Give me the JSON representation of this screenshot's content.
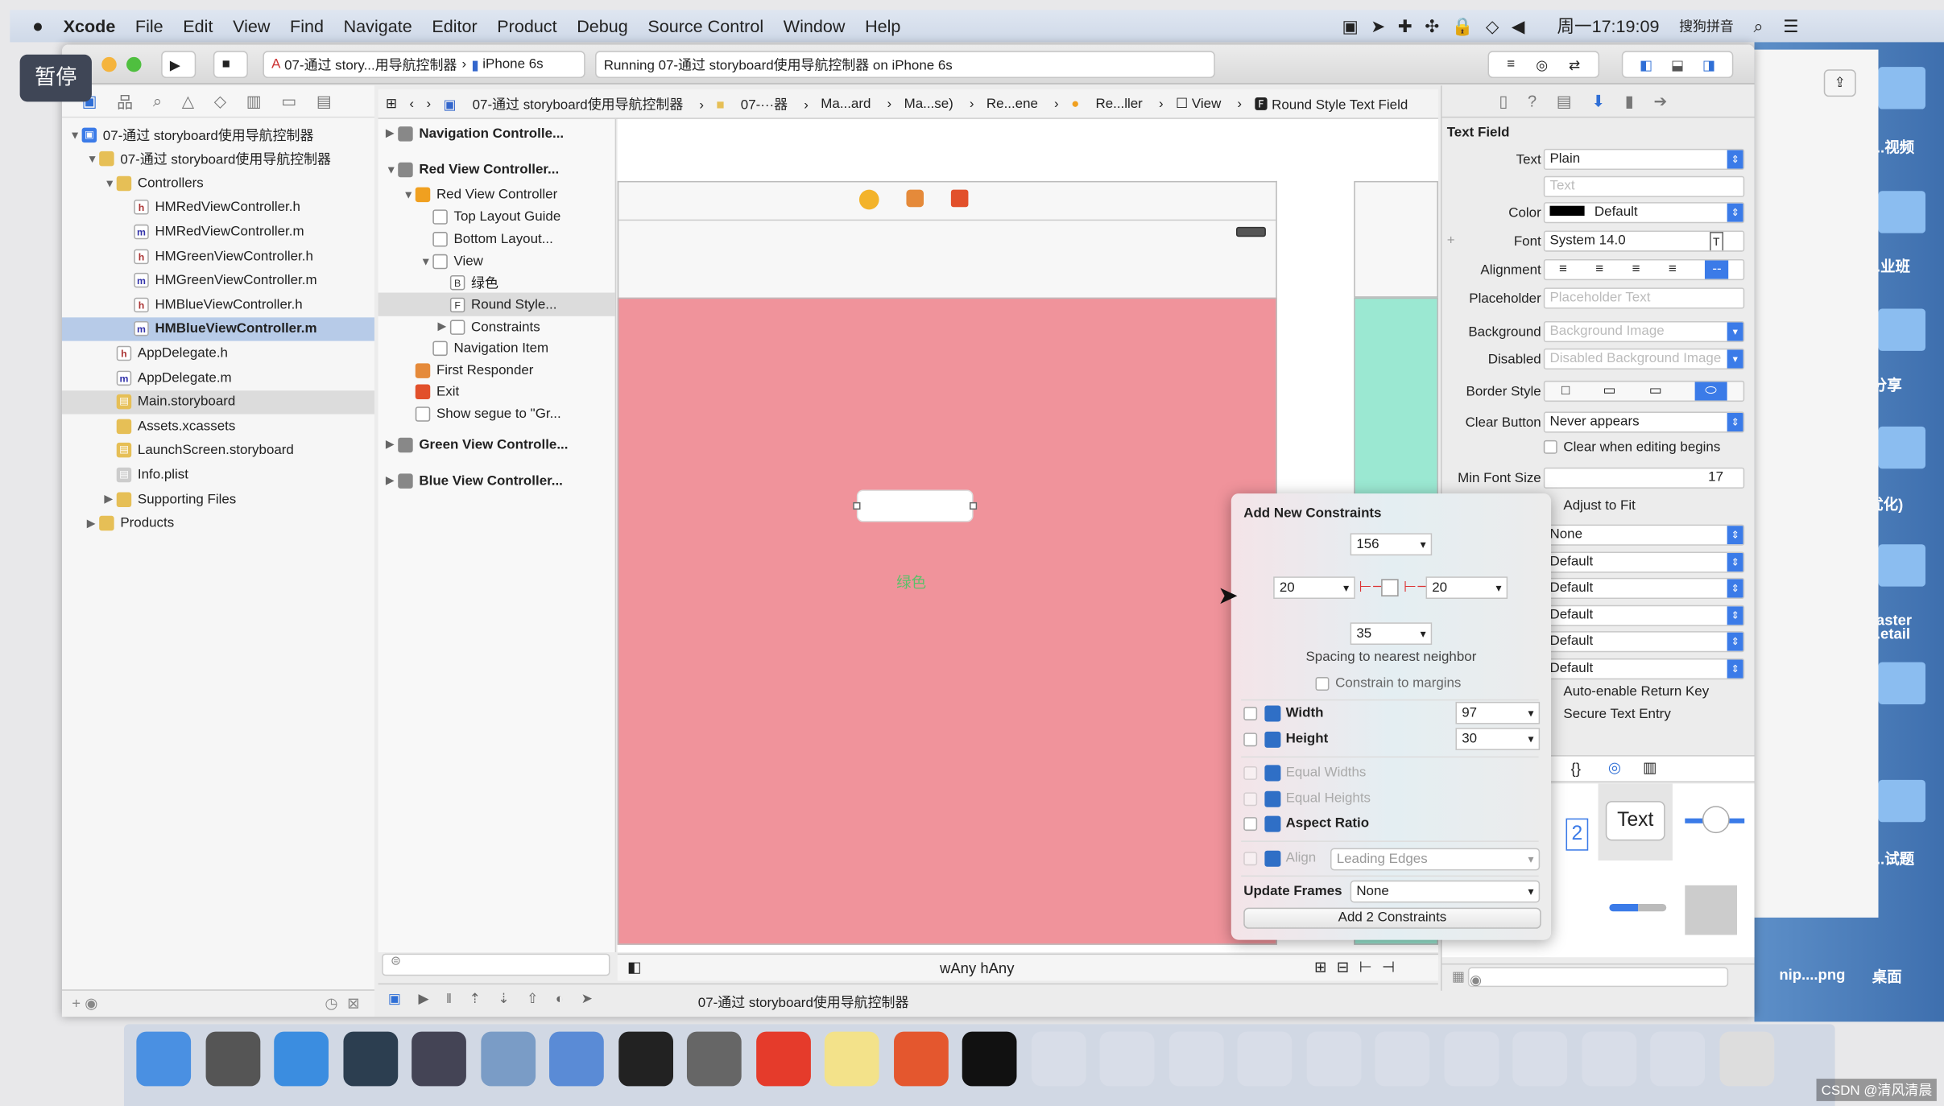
{
  "menubar": {
    "app": "Xcode",
    "items": [
      "File",
      "Edit",
      "View",
      "Find",
      "Navigate",
      "Editor",
      "Product",
      "Debug",
      "Source Control",
      "Window",
      "Help"
    ],
    "clock": "周一17:19:09",
    "input_method": "搜狗拼音"
  },
  "overlay_badge": "暂停",
  "toolbar": {
    "scheme": "07-通过 story...用导航控制器",
    "device": "iPhone 6s",
    "status": "Running 07-通过 storyboard使用导航控制器 on iPhone 6s"
  },
  "breadcrumbs": [
    "07-通过 storyboard使用导航控制器",
    "07-···器",
    "Ma...ard",
    "Ma...se)",
    "Re...ene",
    "Re...ller",
    "View",
    "Round Style Text Field"
  ],
  "navigator": {
    "items": [
      {
        "label": "07-通过 storyboard使用导航控制器",
        "type": "project",
        "level": 0
      },
      {
        "label": "07-通过 storyboard使用导航控制器",
        "type": "folder",
        "level": 1
      },
      {
        "label": "Controllers",
        "type": "folder",
        "level": 2
      },
      {
        "label": "HMRedViewController.h",
        "type": "h",
        "level": 3
      },
      {
        "label": "HMRedViewController.m",
        "type": "m",
        "level": 3
      },
      {
        "label": "HMGreenViewController.h",
        "type": "h",
        "level": 3
      },
      {
        "label": "HMGreenViewController.m",
        "type": "m",
        "level": 3
      },
      {
        "label": "HMBlueViewController.h",
        "type": "h",
        "level": 3
      },
      {
        "label": "HMBlueViewController.m",
        "type": "m",
        "level": 3,
        "selected": true
      },
      {
        "label": "AppDelegate.h",
        "type": "h",
        "level": 2
      },
      {
        "label": "AppDelegate.m",
        "type": "m",
        "level": 2
      },
      {
        "label": "Main.storyboard",
        "type": "sb",
        "level": 2,
        "highlight": true
      },
      {
        "label": "Assets.xcassets",
        "type": "folder",
        "level": 2
      },
      {
        "label": "LaunchScreen.storyboard",
        "type": "sb",
        "level": 2
      },
      {
        "label": "Info.plist",
        "type": "plist",
        "level": 2
      },
      {
        "label": "Supporting Files",
        "type": "folder",
        "level": 2
      },
      {
        "label": "Products",
        "type": "folder",
        "level": 1
      }
    ]
  },
  "outline": {
    "items": [
      {
        "label": "Navigation Controlle...",
        "level": 0,
        "bold": true
      },
      {
        "label": "Red View Controller...",
        "level": 0,
        "bold": true
      },
      {
        "label": "Red View Controller",
        "level": 1
      },
      {
        "label": "Top Layout Guide",
        "level": 2
      },
      {
        "label": "Bottom Layout...",
        "level": 2
      },
      {
        "label": "View",
        "level": 2
      },
      {
        "label": "绿色",
        "level": 3
      },
      {
        "label": "Round Style...",
        "level": 3,
        "selected": true
      },
      {
        "label": "Constraints",
        "level": 3
      },
      {
        "label": "Navigation Item",
        "level": 2
      },
      {
        "label": "First Responder",
        "level": 1
      },
      {
        "label": "Exit",
        "level": 1
      },
      {
        "label": "Show segue to \"Gr...",
        "level": 1
      },
      {
        "label": "Green View Controlle...",
        "level": 0,
        "bold": true
      },
      {
        "label": "Blue View Controller...",
        "level": 0,
        "bold": true
      }
    ]
  },
  "canvas": {
    "label_text": "绿色",
    "size_class": "wAny hAny",
    "view_color": "#f0939b",
    "green_color": "#9be8d2"
  },
  "inspector": {
    "section": "Text Field",
    "text_label": "Text",
    "text_value": "Plain",
    "text_placeholder": "Text",
    "color_label": "Color",
    "color_value": "Default",
    "font_label": "Font",
    "font_value": "System 14.0",
    "alignment_label": "Alignment",
    "placeholder_label": "Placeholder",
    "placeholder_placeholder": "Placeholder Text",
    "background_label": "Background",
    "background_placeholder": "Background Image",
    "disabled_label": "Disabled",
    "disabled_placeholder": "Disabled Background Image",
    "border_label": "Border Style",
    "clear_label": "Clear Button",
    "clear_value": "Never appears",
    "clear_editing": "Clear when editing begins",
    "minfont_label": "Min Font Size",
    "minfont_value": "17",
    "adjust": "Adjust to Fit",
    "selects": [
      "None",
      "Default",
      "Default",
      "Default",
      "Default",
      "Default"
    ],
    "auto_return": "Auto-enable Return Key",
    "secure": "Secure Text Entry",
    "library_text": "Text",
    "library_num": "2"
  },
  "popover": {
    "title": "Add New Constraints",
    "top": "156",
    "left": "20",
    "right": "20",
    "bottom": "35",
    "spacing": "Spacing to nearest neighbor",
    "margins": "Constrain to margins",
    "width_label": "Width",
    "width_value": "97",
    "height_label": "Height",
    "height_value": "30",
    "equal_widths": "Equal Widths",
    "equal_heights": "Equal Heights",
    "aspect": "Aspect Ratio",
    "align": "Align",
    "align_value": "Leading Edges",
    "update_label": "Update Frames",
    "update_value": "None",
    "add_button": "Add 2 Constraints"
  },
  "bottombar": {
    "scheme_path": "07-通过 storyboard使用导航控制器"
  },
  "desktop": {
    "labels": [
      "...视频",
      "..业班",
      "分享",
      "(优化)",
      ".aster",
      "..etail",
      "...试题",
      "nip....png",
      "桌面"
    ]
  },
  "watermark": "CSDN @清风清晨"
}
